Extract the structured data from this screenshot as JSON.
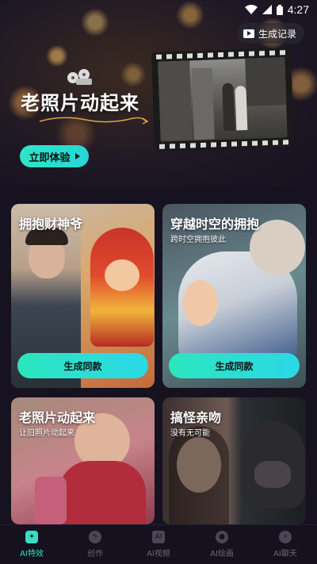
{
  "status_bar": {
    "time": "4:27"
  },
  "hero": {
    "history_label": "生成记录",
    "title": "老照片动起来",
    "try_label": "立即体验"
  },
  "cards": [
    {
      "title": "拥抱财神爷",
      "subtitle": "",
      "button": "生成同款"
    },
    {
      "title": "穿越时空的拥抱",
      "subtitle": "跨时空拥抱彼此",
      "button": "生成同款"
    },
    {
      "title": "老照片动起来",
      "subtitle": "让旧照片动起来",
      "button": ""
    },
    {
      "title": "搞怪亲吻",
      "subtitle": "没有无可能",
      "button": ""
    }
  ],
  "nav": [
    {
      "label": "AI特效",
      "icon": "sparkle-icon",
      "active": true
    },
    {
      "label": "创作",
      "icon": "bolt-icon",
      "active": false
    },
    {
      "label": "AI视频",
      "icon": "ai-video-icon",
      "active": false
    },
    {
      "label": "AI绘画",
      "icon": "palette-icon",
      "active": false
    },
    {
      "label": "AI聊天",
      "icon": "chat-icon",
      "active": false
    }
  ],
  "colors": {
    "accent": "#34e0c2",
    "background": "#16121f"
  }
}
